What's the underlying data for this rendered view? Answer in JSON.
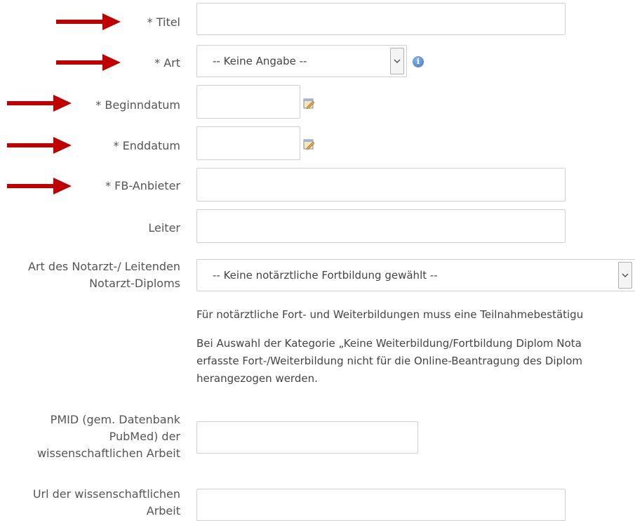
{
  "form": {
    "titel": {
      "label": "* Titel",
      "value": ""
    },
    "art": {
      "label": "* Art",
      "selected": "-- Keine Angabe --"
    },
    "beginndatum": {
      "label": "* Beginndatum",
      "value": ""
    },
    "enddatum": {
      "label": "* Enddatum",
      "value": ""
    },
    "anbieter": {
      "label": "* FB-Anbieter",
      "value": ""
    },
    "leiter": {
      "label": "Leiter",
      "value": ""
    },
    "diplom": {
      "label_line1": "Art des Notarzt-/ Leitenden",
      "label_line2": "Notarzt-Diploms",
      "selected": "-- Keine notärztliche Fortbildung gewählt --"
    },
    "info_text": {
      "p1": "Für notärztliche Fort- und Weiterbildungen muss eine Teilnahmebestätigu",
      "p2_line1": "Bei Auswahl der Kategorie „Keine Weiterbildung/Fortbildung Diplom Nota",
      "p2_line2": "erfasste Fort-/Weiterbildung nicht für die Online-Beantragung des Diplom",
      "p2_line3": "herangezogen werden."
    },
    "pmid": {
      "label_line1": "PMID (gem. Datenbank",
      "label_line2": "PubMed) der",
      "label_line3": "wissenschaftlichen Arbeit",
      "value": ""
    },
    "url": {
      "label_line1": "Url der wissenschaftlichen",
      "label_line2": "Arbeit",
      "value": ""
    }
  },
  "icons": {
    "info": "info-icon",
    "calendar": "calendar-icon",
    "arrow": "red-arrow-icon"
  },
  "colors": {
    "arrow": "#c00000",
    "border": "#d0d0d0",
    "info": "#3b73c4"
  }
}
